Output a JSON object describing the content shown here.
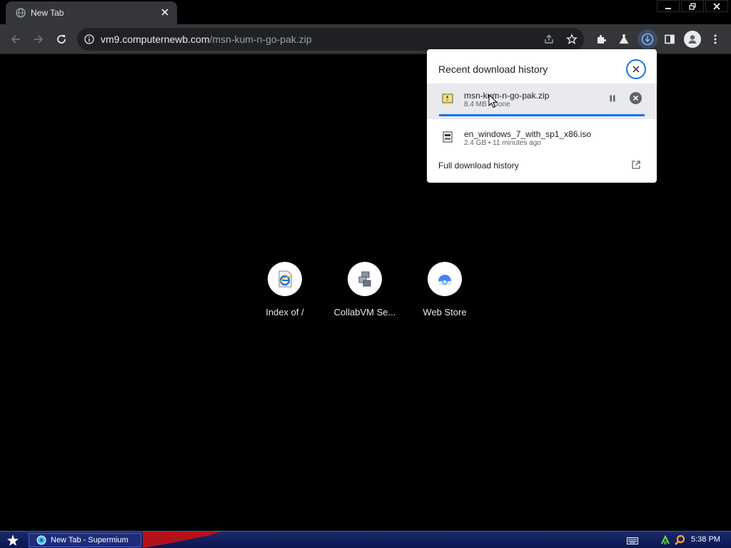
{
  "tab": {
    "title": "New Tab"
  },
  "window_controls": {
    "minimize": "minimize",
    "restore": "restore",
    "close": "close"
  },
  "omnibox": {
    "host": "vm9.computernewb.com",
    "path": "/msn-kum-n-go-pak.zip"
  },
  "shortcuts": [
    {
      "label": "Index of /",
      "icon": "ie-page-icon"
    },
    {
      "label": "CollabVM Se...",
      "icon": "collabvm-icon"
    },
    {
      "label": "Web Store",
      "icon": "web-store-icon"
    }
  ],
  "download_bubble": {
    "title": "Recent download history",
    "items": [
      {
        "name": "msn-kum-n-go-pak.zip",
        "meta": "8.4 MB • Done",
        "progress": 1.0
      },
      {
        "name": "en_windows_7_with_sp1_x86.iso",
        "meta": "2.4 GB • 11 minutes ago"
      }
    ],
    "footer": "Full download history"
  },
  "taskbar": {
    "task_label": "New Tab - Supermium",
    "clock": "5:38 PM"
  },
  "colors": {
    "accent": "#1a73e8",
    "toolbar": "#35363a",
    "page": "#000000"
  }
}
